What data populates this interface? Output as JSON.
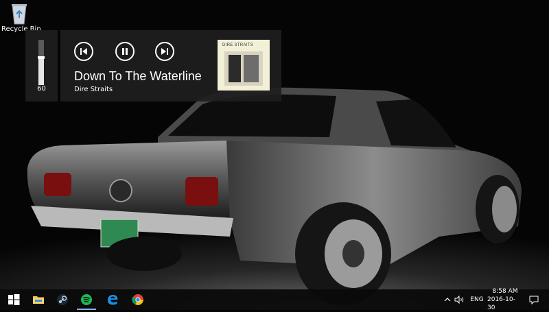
{
  "desktop": {
    "recycle_bin_label": "Recycle Bin"
  },
  "volume": {
    "level": 60,
    "level_text": "60"
  },
  "media": {
    "track_title": "Down To The Waterline",
    "artist": "Dire Straits",
    "album_art_text": "DIRE STRAITS",
    "controls": [
      "previous-icon",
      "pause-icon",
      "next-icon"
    ]
  },
  "taskbar": {
    "pinned": [
      "windows-icon",
      "file-explorer-icon",
      "steam-icon",
      "spotify-icon",
      "edge-icon",
      "chrome-icon"
    ],
    "active_app": "spotify-icon",
    "tray": {
      "language": "ENG",
      "time": "8:58 AM",
      "date": "2016-10-30"
    }
  },
  "colors": {
    "panel_bg": "#1e1e1e",
    "taskbar_bg": "#0a0a0a",
    "active_indicator": "#8ab4e8",
    "license_plate": "#2f8a52"
  }
}
